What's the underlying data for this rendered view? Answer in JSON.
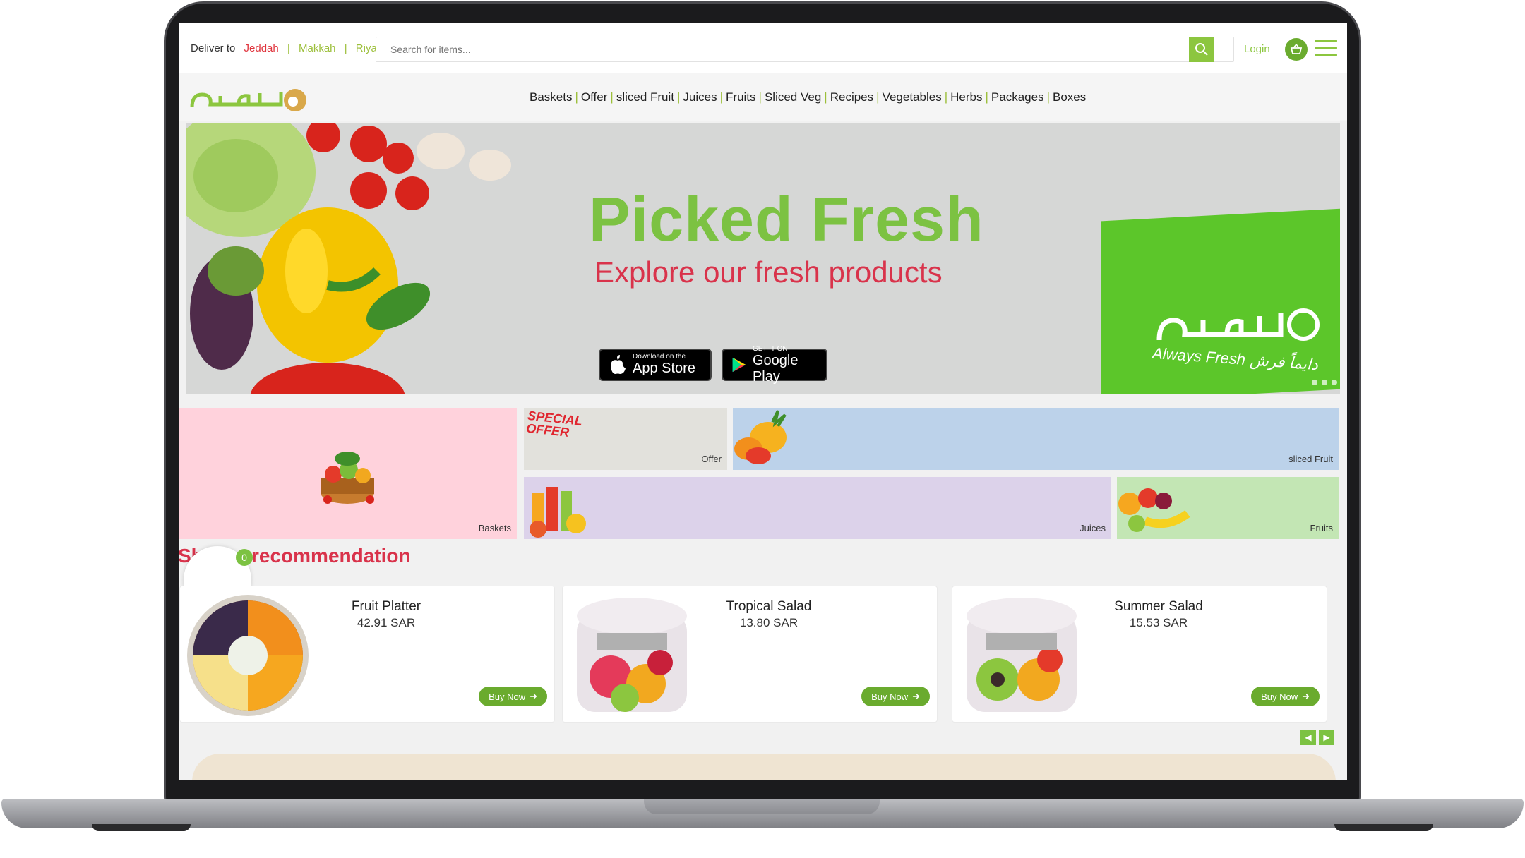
{
  "header": {
    "deliver_label": "Deliver to",
    "cities": [
      "Jeddah",
      "Makkah",
      "Riyadh"
    ],
    "search_placeholder": "Search for items...",
    "login_label": "Login"
  },
  "nav": {
    "items": [
      "Baskets",
      "Offer",
      "sliced Fruit",
      "Juices",
      "Fruits",
      "Sliced Veg",
      "Recipes",
      "Vegetables",
      "Herbs",
      "Packages",
      "Boxes"
    ]
  },
  "hero": {
    "title": "Picked Fresh",
    "subtitle": "Explore our fresh products",
    "app_store_small": "Download on the",
    "app_store_big": "App Store",
    "google_small": "GET IT ON",
    "google_big": "Google Play",
    "box_tagline": "Always Fresh دايماً فرش"
  },
  "categories": {
    "baskets": "Baskets",
    "offer": "Offer",
    "offer_promo": "SPECIAL OFFER",
    "sliced_fruit": "sliced Fruit",
    "juices": "Juices",
    "fruits": "Fruits"
  },
  "recommendation": {
    "title": "recommendation",
    "title_prefix": "Sh",
    "cart_count": "0",
    "buy_label": "Buy Now",
    "products": [
      {
        "name": "Fruit Platter",
        "price": "42.91 SAR"
      },
      {
        "name": "Tropical Salad",
        "price": "13.80 SAR"
      },
      {
        "name": "Summer Salad",
        "price": "15.53 SAR"
      }
    ]
  },
  "colors": {
    "brand_green": "#8cc63f",
    "accent_red": "#d9334b",
    "pink_tile": "#ffd2dc",
    "gray_tile": "#e2e1dc",
    "blue_tile": "#bcd2ea",
    "lavender_tile": "#dcd2ea",
    "green_tile": "#c3e6b4"
  }
}
